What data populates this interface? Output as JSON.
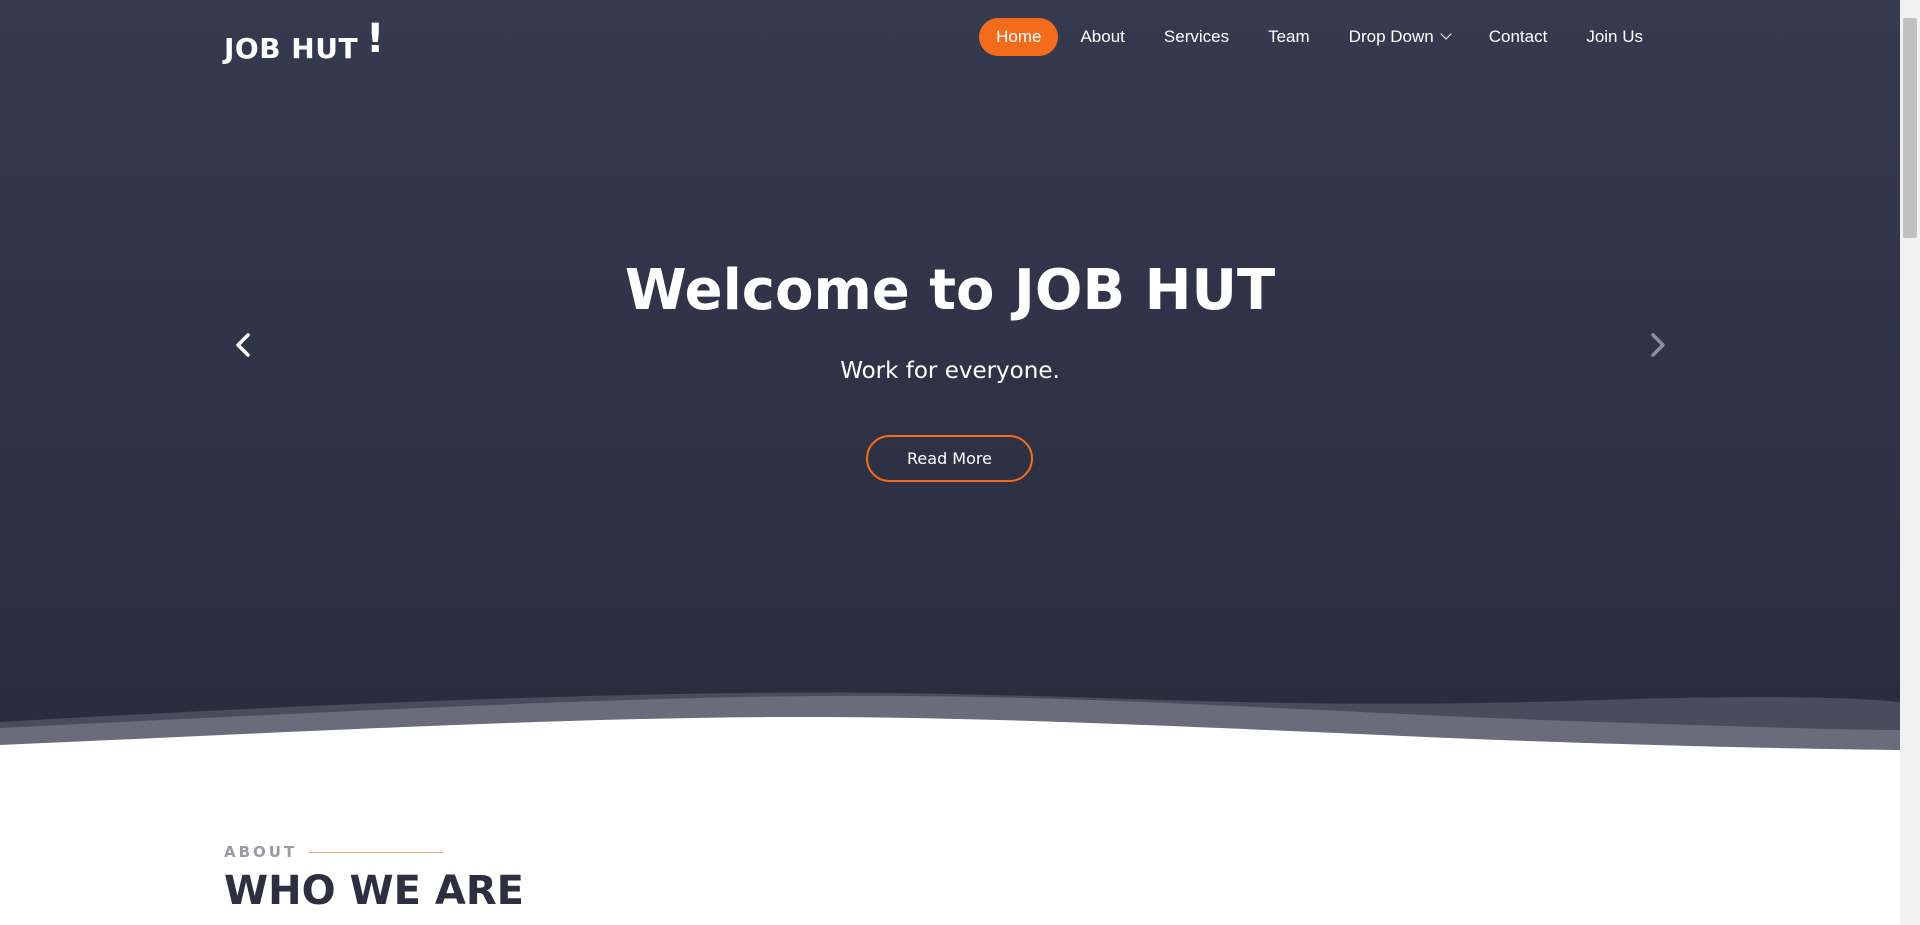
{
  "brand": {
    "logo_text": "JOB HUT",
    "logo_mark": "!"
  },
  "nav": {
    "items": [
      {
        "label": "Home",
        "active": true
      },
      {
        "label": "About"
      },
      {
        "label": "Services"
      },
      {
        "label": "Team"
      },
      {
        "label": "Drop Down",
        "has_dropdown": true
      },
      {
        "label": "Contact"
      },
      {
        "label": "Join Us"
      }
    ]
  },
  "hero": {
    "title": "Welcome to JOB HUT",
    "subtitle": "Work for everyone.",
    "cta_label": "Read More",
    "prev_icon": "chevron-left-icon",
    "next_icon": "chevron-right-icon"
  },
  "about": {
    "label": "ABOUT",
    "title": "WHO WE ARE"
  },
  "colors": {
    "accent": "#f26c1b",
    "hero_bg": "#2f3245",
    "heading_dark": "#2d2f40"
  }
}
